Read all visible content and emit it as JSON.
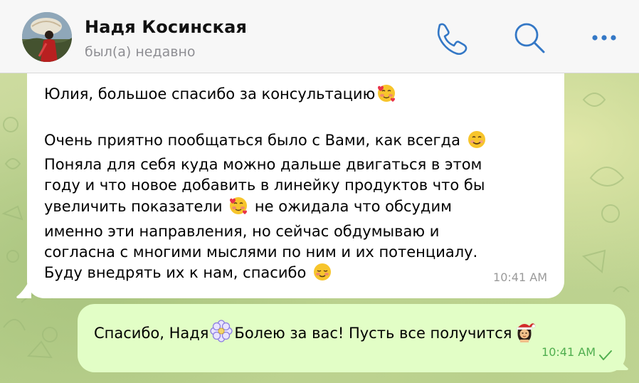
{
  "header": {
    "contact_name": "Надя Косинская",
    "status": "был(а) недавно",
    "icons": [
      "phone-icon",
      "search-icon",
      "more-icon"
    ]
  },
  "messages": {
    "incoming": {
      "lines": [
        "Юлия, большое спасибо за консультацию",
        "",
        "Очень приятно пообщаться было с Вами, как всегда",
        "Поняла для себя куда можно дальше двигаться в этом",
        "году и что новое добавить в линейку продуктов что бы",
        "увеличить показатели",
        "не ожидала что обсудим",
        "именно эти направления, но сейчас обдумываю и",
        "согласна с многими мыслями по ним и их потенциалу.",
        "Буду внедрять их к нам, спасибо"
      ],
      "time": "10:41 AM"
    },
    "outgoing": {
      "text_part1": "Спасибо, Надя",
      "text_part2": "Болею за вас! Пусть все получится",
      "time": "10:41 AM"
    }
  },
  "colors": {
    "accent": "#3478c6",
    "incoming_bubble": "#ffffff",
    "outgoing_bubble": "#e2fec6",
    "outgoing_time": "#4fae4e",
    "header_bg": "#f7f7f7"
  }
}
